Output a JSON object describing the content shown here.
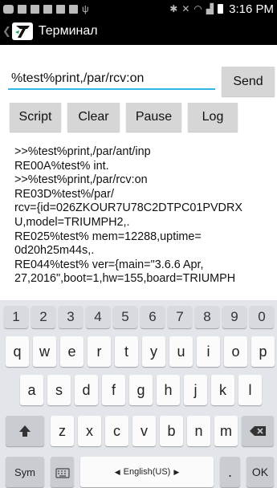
{
  "status_bar": {
    "time": "3:16 PM",
    "left_icons": [
      "message-icon",
      "notification-icon",
      "notification-icon",
      "notification-icon",
      "notification-icon",
      "notification-icon",
      "usb-icon"
    ],
    "right_icons": [
      "bluetooth-icon",
      "mute-icon",
      "wifi-icon",
      "signal-icon",
      "battery-icon"
    ]
  },
  "action_bar": {
    "title": "Терминал"
  },
  "command": {
    "input_value": "%test%print,/par/rcv:on",
    "send_label": "Send"
  },
  "controls": {
    "script_label": "Script",
    "clear_label": "Clear",
    "pause_label": "Pause",
    "log_label": "Log"
  },
  "log_lines": [
    ">>%test%print,/par/ant/inp",
    "RE00A%test% int.",
    ">>%test%print,/par/rcv:on",
    "RE03D%test%/par/",
    "rcv={id=026ZKOUR7U78C2DTPC01PVDRX",
    "U,model=TRIUMPH2,.",
    "RE025%test% mem=12288,uptime=",
    "0d20h25m44s,.",
    "RE044%test% ver={main=\"3.6.6 Apr,",
    "27,2016\",boot=1,hw=155,board=TRIUMPH"
  ],
  "keyboard": {
    "numbers": [
      "1",
      "2",
      "3",
      "4",
      "5",
      "6",
      "7",
      "8",
      "9",
      "0"
    ],
    "row1": [
      "q",
      "w",
      "e",
      "r",
      "t",
      "y",
      "u",
      "i",
      "o",
      "p"
    ],
    "row2": [
      "a",
      "s",
      "d",
      "f",
      "g",
      "h",
      "j",
      "k",
      "l"
    ],
    "row3": [
      "z",
      "x",
      "c",
      "v",
      "b",
      "n",
      "m"
    ],
    "sym_label": "Sym",
    "space_label": "English(US)",
    "period_label": ".",
    "ok_label": "OK",
    "accent_color": "#33b5e5"
  }
}
